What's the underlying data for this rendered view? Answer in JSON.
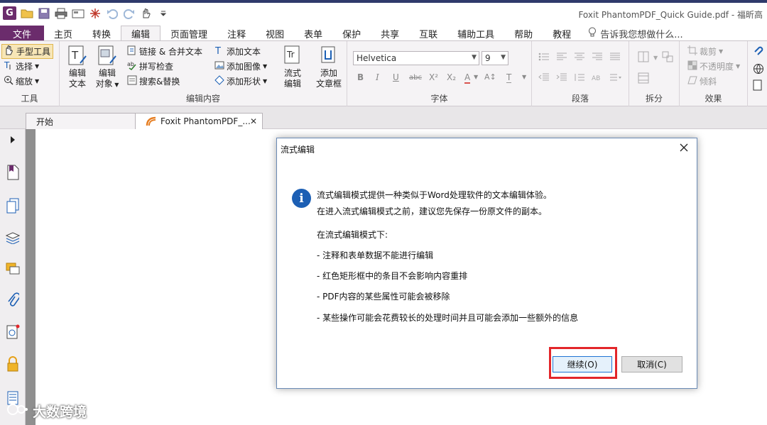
{
  "window": {
    "title": "Foxit PhantomPDF_Quick Guide.pdf - 福昕高"
  },
  "quick_access": {
    "icons": [
      "app-logo",
      "open-folder-icon",
      "save-icon",
      "print-icon",
      "fax-icon",
      "new-tab-icon",
      "undo-icon",
      "redo-icon",
      "hand-tool-icon",
      "customize-dropdown-icon"
    ],
    "logo_letter": "G"
  },
  "tabs": {
    "file": "文件",
    "items": [
      "主页",
      "转换",
      "编辑",
      "页面管理",
      "注释",
      "视图",
      "表单",
      "保护",
      "共享",
      "互联",
      "辅助工具",
      "帮助",
      "教程"
    ],
    "active": "编辑",
    "tell_me": "告诉我您想做什么..."
  },
  "ribbon": {
    "tools_group": {
      "label": "工具",
      "hand": "手型工具",
      "select": "选择",
      "zoom": "缩放"
    },
    "edit_content_group": {
      "label": "编辑内容",
      "edit_text": [
        "编辑",
        "文本"
      ],
      "edit_object": [
        "编辑",
        "对象"
      ],
      "link_merge": "链接 & 合并文本",
      "spell_check": "拼写检查",
      "search_replace": "搜索&替换",
      "add_text": "添加文本",
      "add_image": "添加图像",
      "add_shape": "添加形状",
      "flow_edit": [
        "流式",
        "编辑"
      ],
      "add_textbox": [
        "添加",
        "文章框"
      ]
    },
    "font_group": {
      "label": "字体",
      "font_name": "Helvetica",
      "font_size": "9"
    },
    "paragraph_group": {
      "label": "段落"
    },
    "split_group": {
      "label": "拆分"
    },
    "effects_group": {
      "label": "效果",
      "crop": "裁剪",
      "opacity": "不透明度",
      "skew": "倾斜"
    }
  },
  "doc_tabs": {
    "start": "开始",
    "document": "Foxit PhantomPDF_..."
  },
  "dialog": {
    "title": "流式编辑",
    "line1": "流式编辑模式提供一种类似于Word处理软件的文本编辑体验。",
    "line2": "在进入流式编辑模式之前，建议您先保存一份原文件的副本。",
    "line3": "在流式编辑模式下:",
    "bullets": [
      "- 注释和表单数据不能进行编辑",
      "- 红色矩形框中的条目不会影响内容重排",
      "- PDF内容的某些属性可能会被移除",
      "- 某些操作可能会花费较长的处理时间并且可能会添加一些额外的信息"
    ],
    "continue": "继续(O)",
    "cancel": "取消(C)"
  },
  "watermark": "大数跨境",
  "colors": {
    "brand": "#6b2c6c",
    "info": "#1c5fb4",
    "highlight_box": "#e3262a",
    "primary_border": "#1f74d4"
  }
}
